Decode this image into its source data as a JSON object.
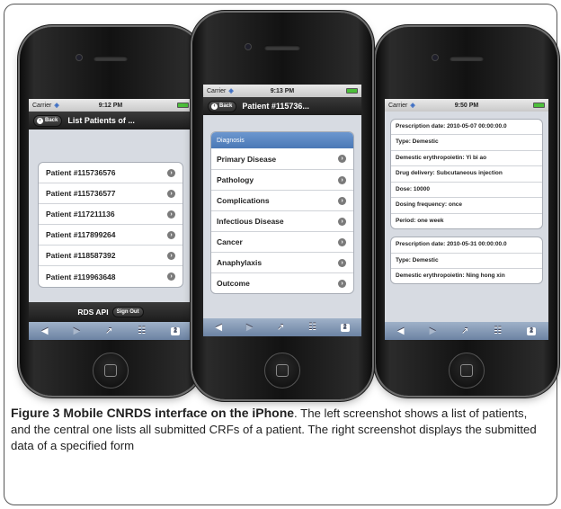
{
  "left_phone": {
    "status": {
      "carrier": "Carrier",
      "time": "9:12 PM"
    },
    "nav": {
      "back_label": "Back",
      "title": "List Patients of ..."
    },
    "patients": [
      "Patient #115736576",
      "Patient #115736577",
      "Patient #117211136",
      "Patient #117899264",
      "Patient #118587392",
      "Patient #119963648"
    ],
    "footer": {
      "title": "RDS API",
      "sign_out_label": "Sign Out"
    }
  },
  "center_phone": {
    "status": {
      "carrier": "Carrier",
      "time": "9:13 PM"
    },
    "nav": {
      "back_label": "Back",
      "title": "Patient #115736..."
    },
    "group_header": "Diagnosis",
    "items": [
      "Primary Disease",
      "Pathology",
      "Complications",
      "Infectious Disease",
      "Cancer",
      "Anaphylaxis",
      "Outcome"
    ]
  },
  "right_phone": {
    "status": {
      "carrier": "Carrier",
      "time": "9:50 PM"
    },
    "form1": [
      "Prescription date: 2010-05-07 00:00:00.0",
      "Type: Demestic",
      "Demestic erythropoietin: Yi bi ao",
      "Drug delivery: Subcutaneous injection",
      "Dose: 10000",
      "Dosing frequency: once",
      "Period: one week"
    ],
    "form2": [
      "Prescription date: 2010-05-31 00:00:00.0",
      "Type: Demestic",
      "Demestic erythropoietin: Ning hong xin"
    ]
  },
  "toolbar": {
    "tabs_count": "2"
  },
  "caption": {
    "lead": "Figure 3 Mobile CNRDS interface on the iPhone",
    "body": ". The left screenshot shows a list of patients, and the central one lists all submitted CRFs of a patient. The right screenshot displays the submitted data of a specified form"
  }
}
